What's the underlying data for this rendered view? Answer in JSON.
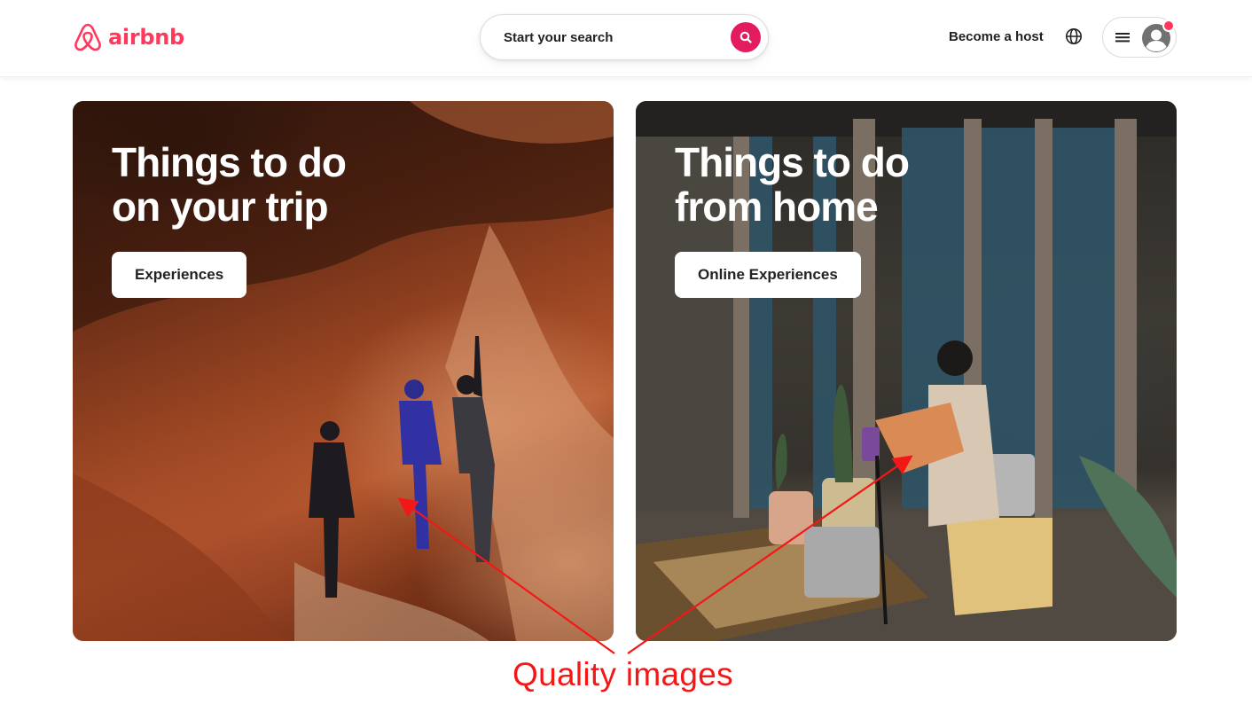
{
  "brand": {
    "name": "airbnb",
    "color": "#FF385C",
    "icon": "airbnb-belo-logo"
  },
  "header": {
    "search_placeholder": "Start your search",
    "search_icon": "search-icon",
    "host_link": "Become a host",
    "globe_icon": "globe-icon",
    "menu_icon": "hamburger-menu-icon",
    "avatar_icon": "user-avatar-icon",
    "accent_color": "#E31C5F"
  },
  "cards": [
    {
      "title": "Things to do\non your trip",
      "button_label": "Experiences"
    },
    {
      "title": "Things to do\nfrom home",
      "button_label": "Online Experiences"
    }
  ],
  "annotation": {
    "text": "Quality images",
    "color": "#F31717"
  }
}
